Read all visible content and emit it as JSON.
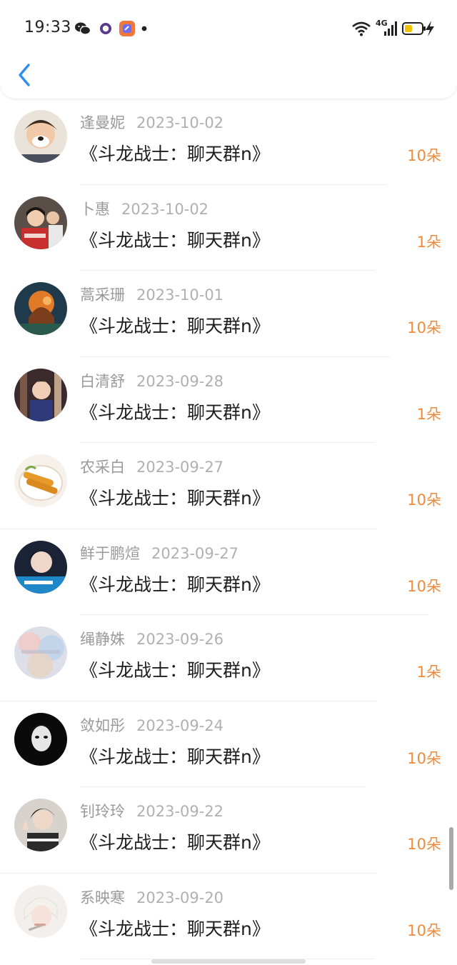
{
  "status_bar": {
    "time": "19:33",
    "network_label": "4G",
    "icons": [
      "wechat-icon",
      "circle-app-icon",
      "app-launcher-icon",
      "notification-dot-icon",
      "wifi-icon",
      "signal-icon",
      "battery-icon",
      "charging-icon"
    ]
  },
  "header": {
    "back_icon": "chevron-left-icon"
  },
  "colors": {
    "accent_blue": "#2f8ff0",
    "amount_orange": "#f08a3a",
    "name_gray": "#9a9a9a",
    "title_black": "#1d1d1d"
  },
  "records": [
    {
      "name": "逢曼妮",
      "date": "2023-10-02",
      "title": "《斗龙战士：聊天群n》",
      "amount": "10朵"
    },
    {
      "name": "卜惠",
      "date": "2023-10-02",
      "title": "《斗龙战士：聊天群n》",
      "amount": "1朵"
    },
    {
      "name": "蒿采珊",
      "date": "2023-10-01",
      "title": "《斗龙战士：聊天群n》",
      "amount": "10朵"
    },
    {
      "name": "白清舒",
      "date": "2023-09-28",
      "title": "《斗龙战士：聊天群n》",
      "amount": "1朵"
    },
    {
      "name": "农采白",
      "date": "2023-09-27",
      "title": "《斗龙战士：聊天群n》",
      "amount": "10朵"
    },
    {
      "name": "鲜于鹏煊",
      "date": "2023-09-27",
      "title": "《斗龙战士：聊天群n》",
      "amount": "10朵"
    },
    {
      "name": "绳静姝",
      "date": "2023-09-26",
      "title": "《斗龙战士：聊天群n》",
      "amount": "1朵"
    },
    {
      "name": "敛如彤",
      "date": "2023-09-24",
      "title": "《斗龙战士：聊天群n》",
      "amount": "10朵"
    },
    {
      "name": "钊玲玲",
      "date": "2023-09-22",
      "title": "《斗龙战士：聊天群n》",
      "amount": "10朵"
    },
    {
      "name": "系映寒",
      "date": "2023-09-20",
      "title": "《斗龙战士：聊天群n》",
      "amount": "10朵"
    }
  ]
}
